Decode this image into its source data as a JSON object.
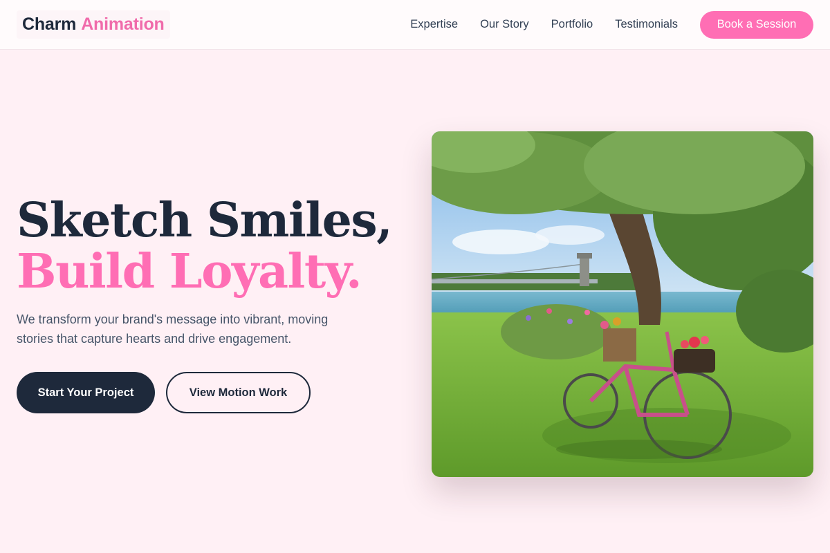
{
  "brand": {
    "name_part1": "Charm",
    "name_part2": "Animation"
  },
  "nav": {
    "items": [
      {
        "label": "Expertise"
      },
      {
        "label": "Our Story"
      },
      {
        "label": "Portfolio"
      },
      {
        "label": "Testimonials"
      }
    ],
    "cta_label": "Book a Session"
  },
  "hero": {
    "headline_line1": "Sketch Smiles,",
    "headline_line2": "Build Loyalty.",
    "subtext": "We transform your brand's message into vibrant, moving stories that capture hearts and drive engagement.",
    "primary_button": "Start Your Project",
    "secondary_button": "View Motion Work",
    "image": {
      "subject": "pink-bicycle-with-flower-baskets-under-tree-by-river"
    }
  },
  "colors": {
    "accent": "#ff6eb4",
    "dark": "#1e293b",
    "background": "#fff0f5"
  }
}
